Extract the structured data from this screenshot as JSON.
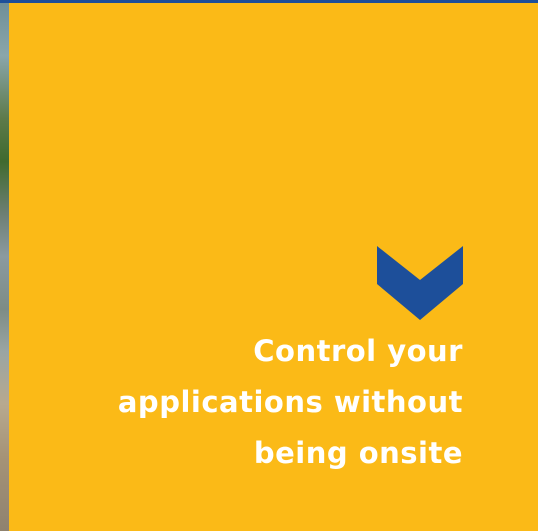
{
  "headline": {
    "line1": "Control your",
    "line2": "applications without",
    "line3": "being onsite"
  },
  "icons": {
    "accent": "chevron-down-icon"
  },
  "colors": {
    "panel": "#fbba17",
    "accent": "#1d4f9a",
    "text": "#ffffff"
  }
}
